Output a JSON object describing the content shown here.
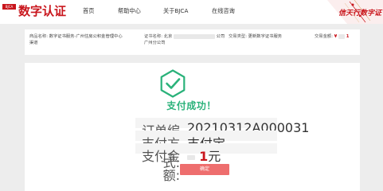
{
  "header": {
    "logo_badge": "BJCA",
    "logo_text": "数字认证",
    "nav": [
      "首页",
      "帮助中心",
      "关于BJCA",
      "在线咨询"
    ],
    "slogan": "信天行数字证"
  },
  "order_info": {
    "product_label": "商品名称:",
    "product_value_line1": "数字证书服务-广州住房公积金管理中心",
    "product_value_line2": "渠道",
    "cert_label": "证书名称:",
    "cert_value_prefix": "北京",
    "cert_value_suffix": "公司",
    "cert_value_line2": "广州分公司",
    "type_label": "交易类型:",
    "type_value": "更新数字证书服务",
    "amount_label": "交易金额:",
    "amount_currency": "¥",
    "amount_value": "1"
  },
  "result": {
    "title": "支付成功！",
    "rows": [
      {
        "key": "订单编号:",
        "value": "20210312A000031"
      },
      {
        "key": "支付方式:",
        "value": "支付宝"
      },
      {
        "key": "支付金额:",
        "value": "1",
        "unit": "元"
      }
    ],
    "confirm_label": "确定"
  },
  "colors": {
    "brand_red": "#c9161d",
    "success_green": "#2ab27a",
    "confirm_button": "#ee6e6e"
  }
}
